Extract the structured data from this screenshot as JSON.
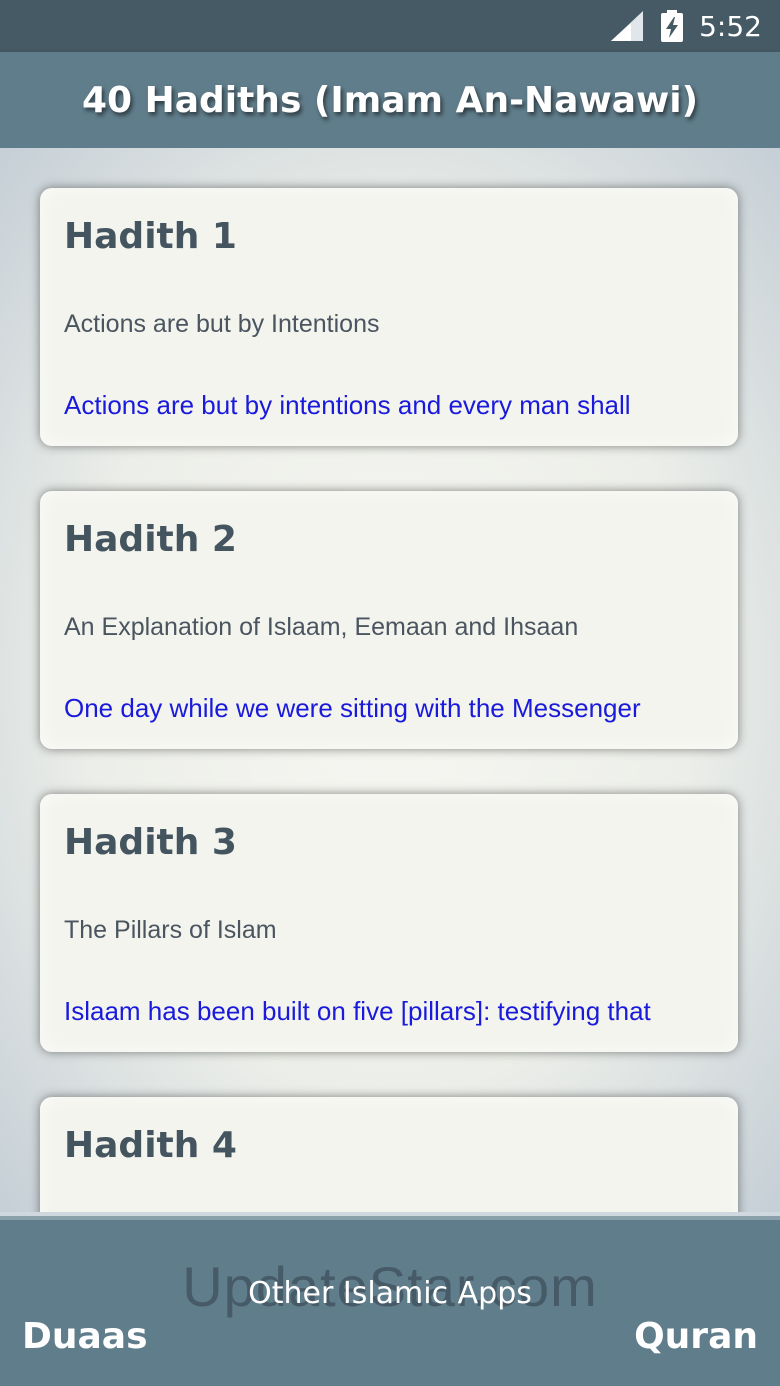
{
  "status_bar": {
    "time": "5:52",
    "icons": [
      "signal-icon",
      "battery-charging-icon"
    ]
  },
  "app_bar": {
    "title": "40 Hadiths (Imam An-Nawawi)"
  },
  "hadiths": [
    {
      "title": "Hadith 1",
      "subtitle": "Actions are but by Intentions",
      "preview": "Actions are but by intentions and every man shall"
    },
    {
      "title": "Hadith 2",
      "subtitle": "An Explanation of Islaam,  Eemaan and Ihsaan",
      "preview": "One day while we were sitting with the Messenger"
    },
    {
      "title": "Hadith 3",
      "subtitle": "The Pillars of Islam",
      "preview": "Islaam has been built on five [pillars]:  testifying that"
    },
    {
      "title": "Hadith 4",
      "subtitle": "",
      "preview": ""
    }
  ],
  "bottom_bar": {
    "watermark": "UpdateStar.com",
    "other_apps_label": "Other Islamic Apps",
    "duaas_label": "Duaas",
    "quran_label": "Quran"
  },
  "colors": {
    "status_bar": "#455a64",
    "app_bar": "#607d8b",
    "card_bg": "#f4f4ee",
    "title_text": "#455560",
    "preview_text": "#1a1adc"
  }
}
